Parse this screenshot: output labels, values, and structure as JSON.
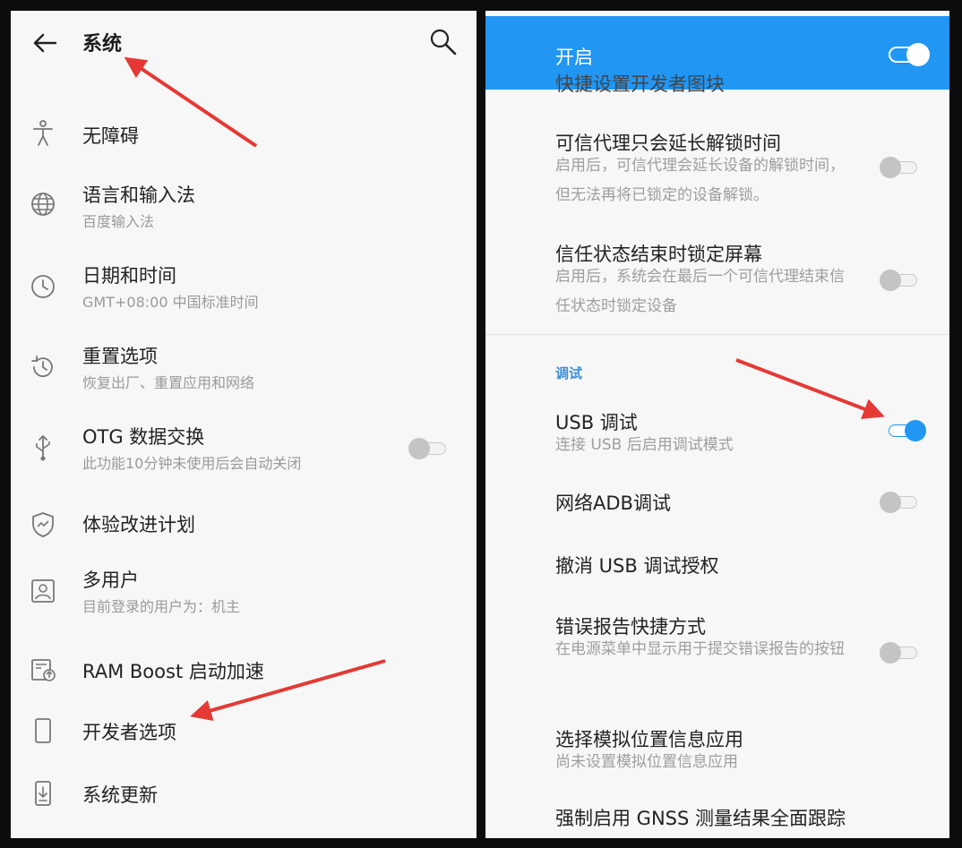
{
  "left": {
    "title": "系统",
    "items": [
      {
        "title": "无障碍",
        "subtitle": "",
        "icon": "accessibility-icon"
      },
      {
        "title": "语言和输入法",
        "subtitle": "百度输入法",
        "icon": "globe-icon"
      },
      {
        "title": "日期和时间",
        "subtitle": "GMT+08:00 中国标准时间",
        "icon": "clock-icon"
      },
      {
        "title": "重置选项",
        "subtitle": "恢复出厂、重置应用和网络",
        "icon": "reset-icon"
      },
      {
        "title": "OTG 数据交换",
        "subtitle": "此功能10分钟未使用后会自动关闭",
        "icon": "usb-icon",
        "switch": "off"
      },
      {
        "title": "体验改进计划",
        "subtitle": "",
        "icon": "shield-icon"
      },
      {
        "title": "多用户",
        "subtitle": "目前登录的用户为：机主",
        "icon": "user-icon"
      },
      {
        "title": "RAM Boost 启动加速",
        "subtitle": "",
        "icon": "ram-boost-icon"
      },
      {
        "title": "开发者选项",
        "subtitle": "",
        "icon": "phone-icon"
      },
      {
        "title": "系统更新",
        "subtitle": "",
        "icon": "system-update-icon"
      }
    ]
  },
  "right": {
    "header_label": "开启",
    "header_switch": "on",
    "clipped_title": "快捷设置开发者图块",
    "section_label": "调试",
    "items": [
      {
        "title": "可信代理只会延长解锁时间",
        "subtitle": "启用后，可信代理会延长设备的解锁时间，但无法再将已锁定的设备解锁。",
        "switch": "off"
      },
      {
        "title": "信任状态结束时锁定屏幕",
        "subtitle": "启用后，系统会在最后一个可信代理结束信任状态时锁定设备",
        "switch": "off"
      },
      {
        "title": "USB 调试",
        "subtitle": "连接 USB 后启用调试模式",
        "switch": "on"
      },
      {
        "title": "网络ADB调试",
        "subtitle": "",
        "switch": "off"
      },
      {
        "title": "撤消 USB 调试授权",
        "subtitle": ""
      },
      {
        "title": "错误报告快捷方式",
        "subtitle": "在电源菜单中显示用于提交错误报告的按钮",
        "switch": "off"
      },
      {
        "title": "选择模拟位置信息应用",
        "subtitle": "尚未设置模拟位置信息应用"
      },
      {
        "title": "强制启用 GNSS 测量结果全面跟踪",
        "subtitle": ""
      }
    ]
  },
  "colors": {
    "accent": "#2196f3",
    "annotation_arrow": "#e53935",
    "panel_bg": "#f7f7f7",
    "frame_bg": "#0d0d0d"
  }
}
